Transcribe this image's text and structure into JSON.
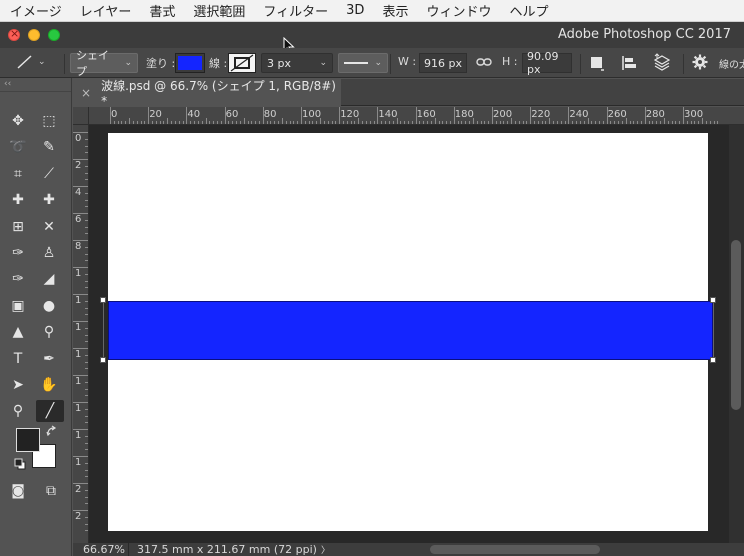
{
  "menu": [
    "イメージ",
    "レイヤー",
    "書式",
    "選択範囲",
    "フィルター",
    "3D",
    "表示",
    "ウィンドウ",
    "ヘルプ"
  ],
  "window": {
    "title": "Adobe Photoshop CC 2017"
  },
  "options": {
    "mode": "シェイプ",
    "fill_label": "塗り :",
    "fill_color": "#1425ff",
    "stroke_label": "線 :",
    "stroke_width": "3 px",
    "w_label": "W :",
    "w_value": "916 px",
    "h_label": "H :",
    "h_value": "90.09 px",
    "line_weight_label": "線の太"
  },
  "document": {
    "tab_title": "波線.psd @ 66.7% (シェイプ 1, RGB/8#) *",
    "shape_color": "#1425ff"
  },
  "ruler": {
    "h_labels": [
      "0",
      "20",
      "40",
      "60",
      "80",
      "100",
      "120",
      "140",
      "160",
      "180",
      "200",
      "220",
      "240",
      "260",
      "280",
      "300"
    ],
    "v_labels": [
      "0",
      "2",
      "4",
      "6",
      "8",
      "1",
      "1",
      "1",
      "1",
      "1",
      "1",
      "1",
      "1",
      "2",
      "2",
      "2"
    ]
  },
  "status": {
    "zoom": "66.67%",
    "doc_size": "317.5 mm x 211.67 mm (72 ppi)",
    "arrow": "〉"
  }
}
